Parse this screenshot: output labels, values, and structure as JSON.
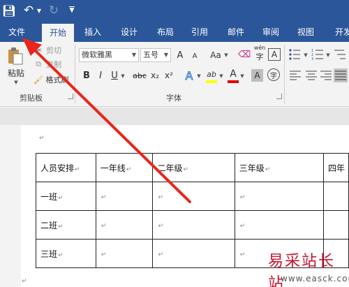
{
  "qat": {
    "save_icon": "save-icon",
    "undo_icon": "undo-icon",
    "redo_icon": "redo-icon",
    "customize_icon": "customize-qat-icon"
  },
  "tabs": [
    {
      "label": "文件"
    },
    {
      "label": "开始",
      "active": true
    },
    {
      "label": "插入"
    },
    {
      "label": "设计"
    },
    {
      "label": "布局"
    },
    {
      "label": "引用"
    },
    {
      "label": "邮件"
    },
    {
      "label": "审阅"
    },
    {
      "label": "视图"
    },
    {
      "label": "开发"
    }
  ],
  "clipboard": {
    "paste_label": "粘贴",
    "cut_label": "剪切",
    "copy_label": "复制",
    "format_painter_label": "格式刷",
    "group_label": "剪贴板"
  },
  "font": {
    "font_name": "微软雅黑",
    "font_size": "五号",
    "grow_font": "A",
    "shrink_font": "A",
    "change_case": "Aa",
    "phonetic_guide": "wén",
    "char_border": "A",
    "bold": "B",
    "italic": "I",
    "underline": "U",
    "strikethrough": "abc",
    "subscript": "x₂",
    "superscript": "x²",
    "text_effects": "A",
    "highlight": "ab",
    "font_color": "A",
    "char_shading": "A",
    "enclose_char": "字",
    "group_label": "字体"
  },
  "colors": {
    "title_bar": "#2b579a",
    "ribbon_bg": "#f3f3f3",
    "highlight_yellow": "#ffff00",
    "font_color_red": "#e00000",
    "arrow_red": "#e8261c",
    "watermark_red": "#c8102e"
  },
  "document": {
    "table": [
      [
        "人员安排",
        "一年线",
        "二年级",
        "三年级",
        "四年"
      ],
      [
        "一班",
        "",
        "",
        "",
        ""
      ],
      [
        "二班",
        "",
        "",
        "",
        ""
      ],
      [
        "三班",
        "",
        "",
        "",
        ""
      ]
    ],
    "paragraph_mark": "↵"
  },
  "watermark": {
    "chinese": "易采站长站",
    "url": "www.easck.com"
  }
}
